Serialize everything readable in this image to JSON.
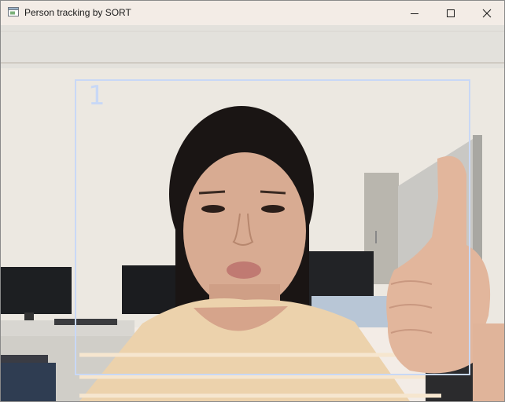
{
  "window": {
    "title": "Person tracking by SORT",
    "icon": "app-window-icon"
  },
  "controls": {
    "minimize_icon": "minimize-icon",
    "maximize_icon": "maximize-icon",
    "close_icon": "close-icon"
  },
  "tracking": {
    "track_id": "1",
    "box_color": "#c8d8f6"
  }
}
